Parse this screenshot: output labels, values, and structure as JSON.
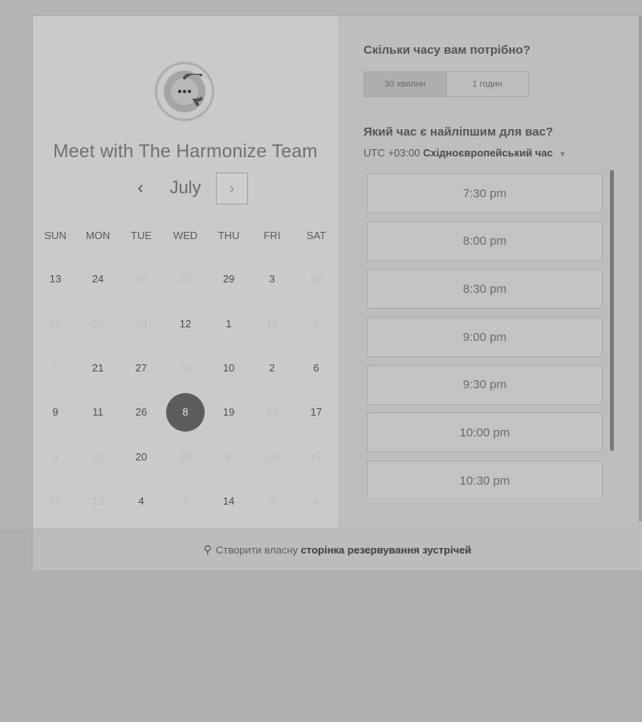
{
  "scheduler": {
    "title": "Meet with The Harmonize Team",
    "month": "July",
    "prev_icon": "‹",
    "next_icon": "›",
    "weekdays": [
      "SUN",
      "MON",
      "TUE",
      "WED",
      "THU",
      "FRI",
      "SAT"
    ],
    "weeks": [
      [
        {
          "d": "13",
          "dim": false
        },
        {
          "d": "24",
          "dim": false
        },
        {
          "d": "19",
          "dim": true
        },
        {
          "d": "22",
          "dim": true
        },
        {
          "d": "29",
          "dim": false
        },
        {
          "d": "3",
          "dim": false
        },
        {
          "d": "20",
          "dim": true
        }
      ],
      [
        {
          "d": "21",
          "dim": true
        },
        {
          "d": "22",
          "dim": true
        },
        {
          "d": "28",
          "dim": true
        },
        {
          "d": "12",
          "dim": false
        },
        {
          "d": "1",
          "dim": false
        },
        {
          "d": "15",
          "dim": true
        },
        {
          "d": "8",
          "dim": true
        }
      ],
      [
        {
          "d": "8",
          "dim": true
        },
        {
          "d": "21",
          "dim": false
        },
        {
          "d": "27",
          "dim": false
        },
        {
          "d": "31",
          "dim": true
        },
        {
          "d": "10",
          "dim": false
        },
        {
          "d": "2",
          "dim": false
        },
        {
          "d": "6",
          "dim": false
        }
      ],
      [
        {
          "d": "9",
          "dim": false
        },
        {
          "d": "11",
          "dim": false
        },
        {
          "d": "26",
          "dim": false
        },
        {
          "d": "8",
          "dim": false,
          "selected": true
        },
        {
          "d": "19",
          "dim": false
        },
        {
          "d": "27",
          "dim": true
        },
        {
          "d": "17",
          "dim": false
        }
      ],
      [
        {
          "d": "9",
          "dim": true
        },
        {
          "d": "21",
          "dim": true
        },
        {
          "d": "20",
          "dim": false
        },
        {
          "d": "20",
          "dim": true
        },
        {
          "d": "9",
          "dim": true
        },
        {
          "d": "18",
          "dim": true
        },
        {
          "d": "17",
          "dim": true
        }
      ],
      [
        {
          "d": "19",
          "dim": true
        },
        {
          "d": "13",
          "dim": true
        },
        {
          "d": "4",
          "dim": false
        },
        {
          "d": "1",
          "dim": true
        },
        {
          "d": "14",
          "dim": false
        },
        {
          "d": "9",
          "dim": true
        },
        {
          "d": "4",
          "dim": true
        }
      ]
    ]
  },
  "booking": {
    "duration_question": "Скільки часу вам потрібно?",
    "duration_options": [
      "30 хвилин",
      "1 годин"
    ],
    "time_question": "Який час є найліпшим для вас?",
    "timezone_offset": "UTC +03:00",
    "timezone_name": "Східноєвропейський час",
    "slots": [
      "7:30 pm",
      "8:00 pm",
      "8:30 pm",
      "9:00 pm",
      "9:30 pm",
      "10:00 pm",
      "10:30 pm"
    ]
  },
  "footer": {
    "prefix": "Створити власну",
    "link": "сторінка резервування зустрічей"
  }
}
